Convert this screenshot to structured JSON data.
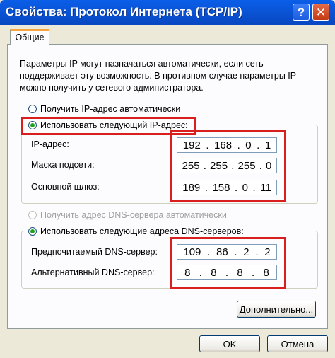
{
  "window": {
    "title": "Свойства: Протокол Интернета (TCP/IP)",
    "help_label": "?",
    "close_label": "✕"
  },
  "tabs": [
    {
      "label": "Общие",
      "active": true
    }
  ],
  "description": "Параметры IP могут назначаться автоматически, если сеть поддерживает эту возможность. В противном случае параметры IP можно получить у сетевого администратора.",
  "ip_mode": {
    "auto_label": "Получить IP-адрес автоматически",
    "manual_label": "Использовать следующий IP-адрес:",
    "selected": "manual"
  },
  "ip_fields": [
    {
      "label": "IP-адрес:",
      "octets": [
        "192",
        "168",
        "0",
        "1"
      ]
    },
    {
      "label": "Маска подсети:",
      "octets": [
        "255",
        "255",
        "255",
        "0"
      ]
    },
    {
      "label": "Основной шлюз:",
      "octets": [
        "189",
        "158",
        "0",
        "11"
      ]
    }
  ],
  "dns_mode": {
    "auto_label": "Получить адрес DNS-сервера автоматически",
    "manual_label": "Использовать следующие адреса DNS-серверов:",
    "selected": "manual"
  },
  "dns_fields": [
    {
      "label": "Предпочитаемый DNS-сервер:",
      "octets": [
        "109",
        "86",
        "2",
        "2"
      ]
    },
    {
      "label": "Альтернативный DNS-сервер:",
      "octets": [
        "8",
        "8",
        "8",
        "8"
      ]
    }
  ],
  "buttons": {
    "advanced": "Дополнительно...",
    "ok": "OK",
    "cancel": "Отмена"
  },
  "colors": {
    "titlebar": "#0a55d8",
    "highlight": "#d91e1e",
    "radio_dot": "#21a121"
  }
}
